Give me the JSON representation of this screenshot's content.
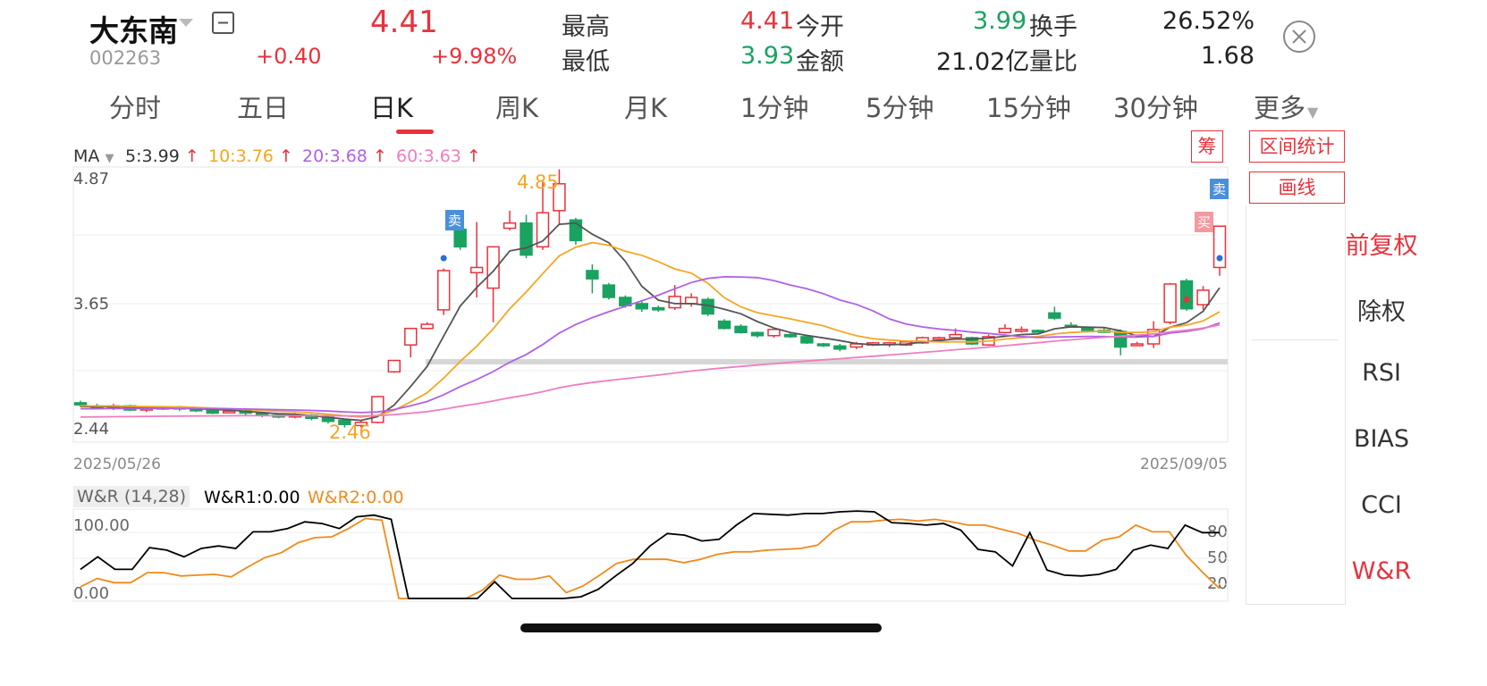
{
  "header": {
    "name": "大东南",
    "code": "002263",
    "price": "4.41",
    "change": "+0.40",
    "change_pct": "+9.98%",
    "stats": [
      {
        "label": "最高",
        "value": "4.41",
        "color": "#e8323c"
      },
      {
        "label": "今开",
        "value": "3.99",
        "color": "#1aa260"
      },
      {
        "label": "换手",
        "value": "26.52%",
        "color": "#222222"
      },
      {
        "label": "最低",
        "value": "3.93",
        "color": "#1aa260"
      },
      {
        "label": "金额",
        "value": "21.02亿",
        "color": "#222222"
      },
      {
        "label": "量比",
        "value": "1.68",
        "color": "#222222"
      }
    ]
  },
  "tabs": [
    "分时",
    "五日",
    "日K",
    "周K",
    "月K",
    "1分钟",
    "5分钟",
    "15分钟",
    "30分钟",
    "更多"
  ],
  "active_tab": "日K",
  "ma_legend": {
    "label": "MA",
    "ma5": "5:3.99",
    "ma10": "10:3.76",
    "ma20": "20:3.68",
    "ma60": "60:3.63"
  },
  "buttons": {
    "chip": "筹",
    "interval_stats": "区间统计",
    "draw": "画线"
  },
  "sidebar": [
    "前复权",
    "除权",
    "RSI",
    "BIAS",
    "CCI",
    "W&R"
  ],
  "sidebar_active": "前复权",
  "sidebar_active2": "W&R",
  "kline": {
    "y_labels": [
      "4.87",
      "3.65",
      "2.44"
    ],
    "high_marker": "4.85",
    "low_marker": "2.46",
    "date_start": "2025/05/26",
    "date_end": "2025/09/05",
    "sell_tag": "卖",
    "buy_tag": "买"
  },
  "wr": {
    "title": "W&R (14,28)",
    "wr1": "W&R1:0.00",
    "wr2": "W&R2:0.00",
    "y_left": [
      "100.00",
      "0.00"
    ],
    "y_right": [
      "80",
      "50",
      "20"
    ]
  },
  "colors": {
    "up": "#e8323c",
    "down": "#1aa260",
    "ma5": "#555555",
    "ma10": "#f5a623",
    "ma20": "#b061e6",
    "ma60": "#f07dc0",
    "wr1": "#000000",
    "wr2": "#f08a1c"
  },
  "chart_data": {
    "type": "candlestick",
    "ylim": [
      2.44,
      4.87
    ],
    "candles": [
      [
        2.7,
        2.68,
        2.72,
        2.66
      ],
      [
        2.67,
        2.65,
        2.69,
        2.64
      ],
      [
        2.65,
        2.67,
        2.69,
        2.63
      ],
      [
        2.67,
        2.63,
        2.68,
        2.62
      ],
      [
        2.63,
        2.65,
        2.66,
        2.61
      ],
      [
        2.64,
        2.66,
        2.67,
        2.63
      ],
      [
        2.66,
        2.64,
        2.67,
        2.62
      ],
      [
        2.64,
        2.63,
        2.65,
        2.61
      ],
      [
        2.64,
        2.6,
        2.65,
        2.59
      ],
      [
        2.61,
        2.62,
        2.63,
        2.6
      ],
      [
        2.62,
        2.6,
        2.63,
        2.58
      ],
      [
        2.6,
        2.58,
        2.61,
        2.56
      ],
      [
        2.58,
        2.57,
        2.6,
        2.55
      ],
      [
        2.57,
        2.58,
        2.6,
        2.55
      ],
      [
        2.58,
        2.55,
        2.59,
        2.53
      ],
      [
        2.56,
        2.52,
        2.57,
        2.5
      ],
      [
        2.53,
        2.49,
        2.54,
        2.46
      ],
      [
        2.48,
        2.51,
        2.53,
        2.46
      ],
      [
        2.51,
        2.76,
        2.76,
        2.5
      ],
      [
        3.0,
        3.11,
        3.11,
        2.99
      ],
      [
        3.26,
        3.42,
        3.42,
        3.14
      ],
      [
        3.42,
        3.46,
        3.48,
        3.42
      ],
      [
        3.6,
        3.98,
        4.0,
        3.55
      ],
      [
        4.38,
        4.21,
        4.48,
        4.18
      ],
      [
        3.96,
        4.01,
        4.45,
        3.72
      ],
      [
        3.81,
        4.21,
        4.21,
        3.48
      ],
      [
        4.39,
        4.44,
        4.56,
        4.37
      ],
      [
        4.44,
        4.13,
        4.52,
        4.1
      ],
      [
        4.21,
        4.54,
        4.85,
        4.18
      ],
      [
        4.56,
        4.82,
        4.96,
        4.42
      ],
      [
        4.47,
        4.27,
        4.49,
        4.23
      ],
      [
        3.98,
        3.9,
        4.04,
        3.76
      ],
      [
        3.84,
        3.72,
        3.86,
        3.7
      ],
      [
        3.72,
        3.64,
        3.74,
        3.62
      ],
      [
        3.66,
        3.61,
        3.69,
        3.58
      ],
      [
        3.62,
        3.6,
        3.64,
        3.58
      ],
      [
        3.62,
        3.73,
        3.84,
        3.6
      ],
      [
        3.66,
        3.72,
        3.76,
        3.63
      ],
      [
        3.7,
        3.56,
        3.72,
        3.54
      ],
      [
        3.49,
        3.42,
        3.51,
        3.41
      ],
      [
        3.44,
        3.38,
        3.46,
        3.37
      ],
      [
        3.38,
        3.35,
        3.39,
        3.33
      ],
      [
        3.35,
        3.41,
        3.42,
        3.33
      ],
      [
        3.36,
        3.34,
        3.38,
        3.33
      ],
      [
        3.34,
        3.28,
        3.35,
        3.27
      ],
      [
        3.27,
        3.26,
        3.28,
        3.24
      ],
      [
        3.25,
        3.22,
        3.27,
        3.2
      ],
      [
        3.24,
        3.27,
        3.29,
        3.22
      ],
      [
        3.26,
        3.28,
        3.29,
        3.25
      ],
      [
        3.27,
        3.28,
        3.29,
        3.24
      ],
      [
        3.26,
        3.29,
        3.3,
        3.25
      ],
      [
        3.28,
        3.33,
        3.34,
        3.27
      ],
      [
        3.32,
        3.33,
        3.34,
        3.3
      ],
      [
        3.33,
        3.36,
        3.42,
        3.31
      ],
      [
        3.33,
        3.27,
        3.34,
        3.26
      ],
      [
        3.26,
        3.34,
        3.36,
        3.25
      ],
      [
        3.38,
        3.42,
        3.46,
        3.37
      ],
      [
        3.4,
        3.41,
        3.44,
        3.38
      ],
      [
        3.4,
        3.39,
        3.41,
        3.38
      ],
      [
        3.57,
        3.52,
        3.63,
        3.5
      ],
      [
        3.45,
        3.44,
        3.48,
        3.43
      ],
      [
        3.43,
        3.4,
        3.44,
        3.38
      ],
      [
        3.4,
        3.39,
        3.42,
        3.38
      ],
      [
        3.39,
        3.24,
        3.41,
        3.16
      ],
      [
        3.26,
        3.27,
        3.29,
        3.25
      ],
      [
        3.27,
        3.41,
        3.49,
        3.23
      ],
      [
        3.48,
        3.85,
        3.86,
        3.46
      ],
      [
        3.88,
        3.61,
        3.9,
        3.59
      ],
      [
        3.65,
        3.79,
        3.83,
        3.6
      ],
      [
        4.01,
        4.41,
        4.41,
        3.93
      ]
    ]
  }
}
